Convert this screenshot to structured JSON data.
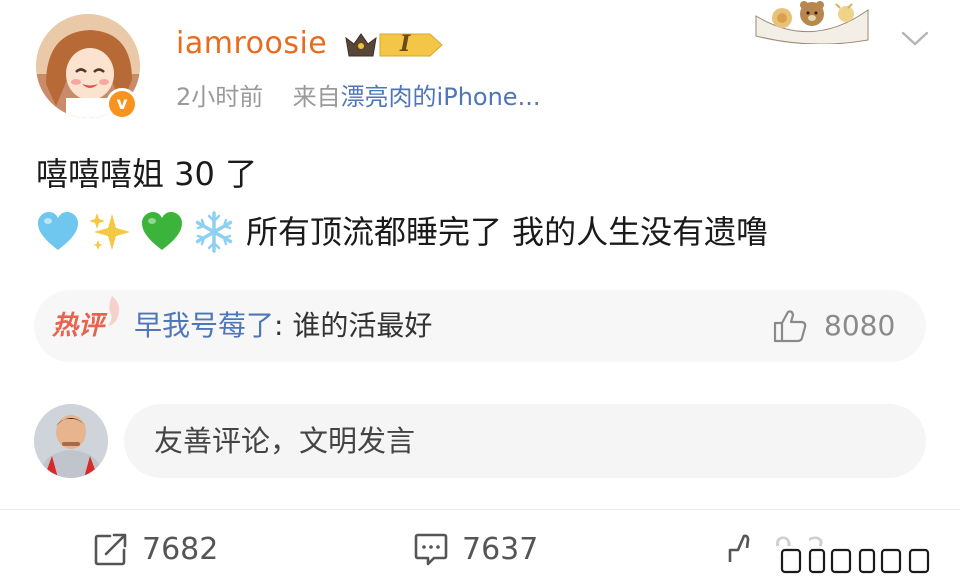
{
  "post": {
    "author": {
      "username": "iamroosie",
      "badge_level": "I",
      "verified_mark": "v"
    },
    "meta": {
      "time": "2小时前",
      "source_prefix": "来自",
      "source_name": "漂亮肉的iPhone..."
    },
    "content": {
      "line1": "嘻嘻嘻姐 30 了",
      "line2_emojis": [
        "light-blue-heart-icon",
        "sparkles-icon",
        "green-heart-icon",
        "snowflake-icon"
      ],
      "line2_text": "所有顶流都睡完了 我的人生没有遗噜"
    }
  },
  "hot_comment": {
    "tag": "热评",
    "user": "早我号莓了",
    "separator": ": ",
    "text": "谁的活最好",
    "like_count": "8080"
  },
  "comment_box": {
    "placeholder": "友善评论，文明发言"
  },
  "actions": {
    "repost_count": "7682",
    "comment_count": "7637",
    "like_count_obscured": "9.2"
  },
  "colors": {
    "username": "#e86c1e",
    "link_blue": "#4f76b8",
    "hot_tag": "#e8634f",
    "gray_text": "#9a9a9a"
  }
}
